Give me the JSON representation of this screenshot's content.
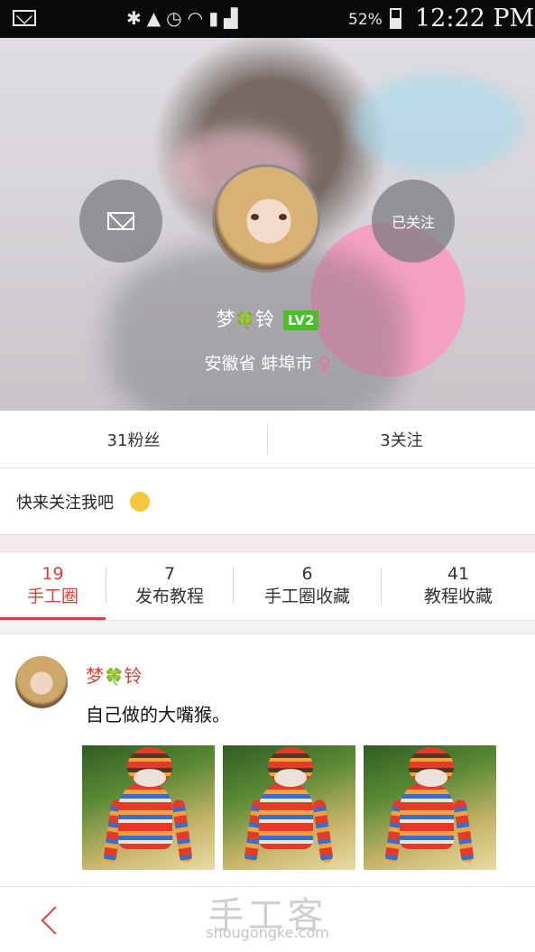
{
  "status_bar": {
    "battery": "52%",
    "time": "12:22 PM",
    "icons": [
      "mail-icon",
      "bluetooth-icon",
      "mute-icon",
      "alarm-icon",
      "wifi-icon",
      "sim-icon",
      "signal-icon",
      "battery-icon"
    ]
  },
  "profile": {
    "name": "梦🍀铃",
    "name_left": "梦",
    "name_right": "铃",
    "level": "LV2",
    "location": "安徽省 蚌埠市",
    "gender_symbol": "♀",
    "follow_button": "已关注"
  },
  "counts": {
    "fans": "31粉丝",
    "following": "3关注"
  },
  "bio": "快来关注我吧",
  "tabs": [
    {
      "count": "19",
      "label": "手工圈",
      "active": true
    },
    {
      "count": "7",
      "label": "发布教程",
      "active": false
    },
    {
      "count": "6",
      "label": "手工圈收藏",
      "active": false
    },
    {
      "count": "41",
      "label": "教程收藏",
      "active": false
    }
  ],
  "post": {
    "author": "梦🍀铃",
    "author_left": "梦",
    "author_right": "铃",
    "text": "自己做的大嘴猴。"
  },
  "watermark": {
    "cn": "手工客",
    "en": "shougongke.com"
  },
  "colors": {
    "accent": "#d9403b",
    "level_badge": "#4bbe2a"
  }
}
